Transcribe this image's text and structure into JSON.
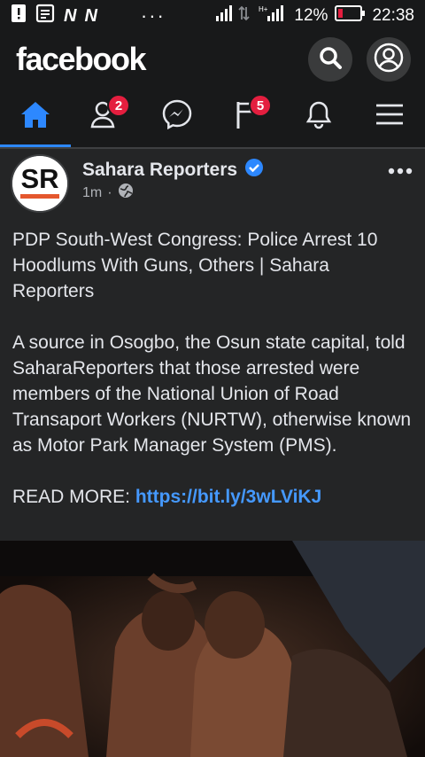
{
  "status_bar": {
    "battery": "12%",
    "time": "22:38",
    "net_label": "N"
  },
  "app": {
    "logo": "facebook"
  },
  "tabs": {
    "friends_badge": "2",
    "pages_badge": "5"
  },
  "post": {
    "author": "Sahara Reporters",
    "time": "1m",
    "avatar_text": "SR",
    "headline": "PDP South-West Congress: Police Arrest 10 Hoodlums With Guns, Others | Sahara Reporters",
    "body": "A source in Osogbo, the Osun state capital, told SaharaReporters that those arrested were members of the National Union of Road Transaport Workers (NURTW), otherwise known as Motor Park Manager System (PMS).",
    "read_more_label": "READ MORE: ",
    "link": "https://bit.ly/3wLViKJ"
  },
  "colors": {
    "accent": "#2d88ff",
    "badge": "#e41e3f",
    "link": "#4599ff",
    "verified": "#2d88ff",
    "avatar_ring": "#e4572e"
  },
  "icons": [
    "warning-icon",
    "gallery-icon",
    "signal-icon",
    "battery-icon",
    "search-icon",
    "profile-icon",
    "home-icon",
    "friends-icon",
    "messenger-icon",
    "pages-icon",
    "bell-icon",
    "menu-icon",
    "verified-icon",
    "globe-icon",
    "more-icon"
  ]
}
